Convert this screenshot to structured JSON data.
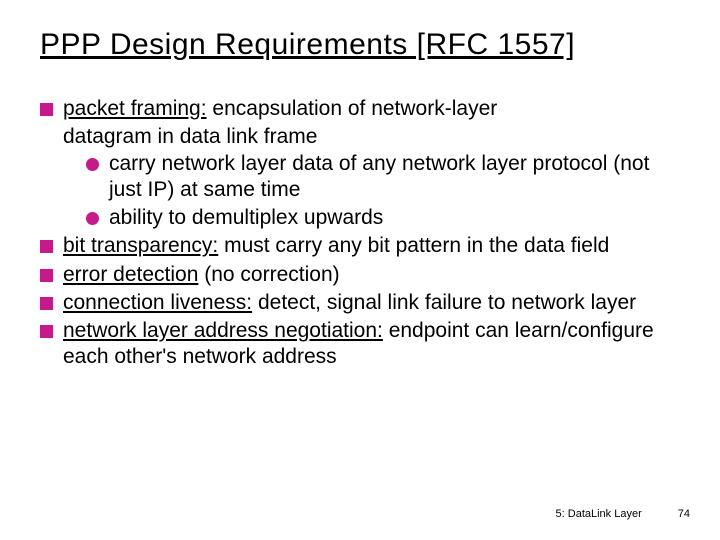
{
  "title": "PPP Design Requirements [RFC 1557]",
  "bullets": {
    "b1_lead": "packet framing:",
    "b1_rest": " encapsulation of network-layer",
    "b1_cont": "datagram in data link frame",
    "b1_s1": "carry network layer data of any network layer protocol (not just IP) at same time",
    "b1_s2": "ability to demultiplex upwards",
    "b2_lead": "bit transparency:",
    "b2_rest": " must carry any bit pattern in the data field",
    "b3_lead": "error detection",
    "b3_rest": " (no correction)",
    "b4_lead": "connection liveness:",
    "b4_rest": " detect, signal link failure to network layer",
    "b5_lead": "network layer address negotiation:",
    "b5_rest": " endpoint can learn/configure each other's network address"
  },
  "footer": {
    "chapter": "5: DataLink Layer",
    "page": "74"
  }
}
